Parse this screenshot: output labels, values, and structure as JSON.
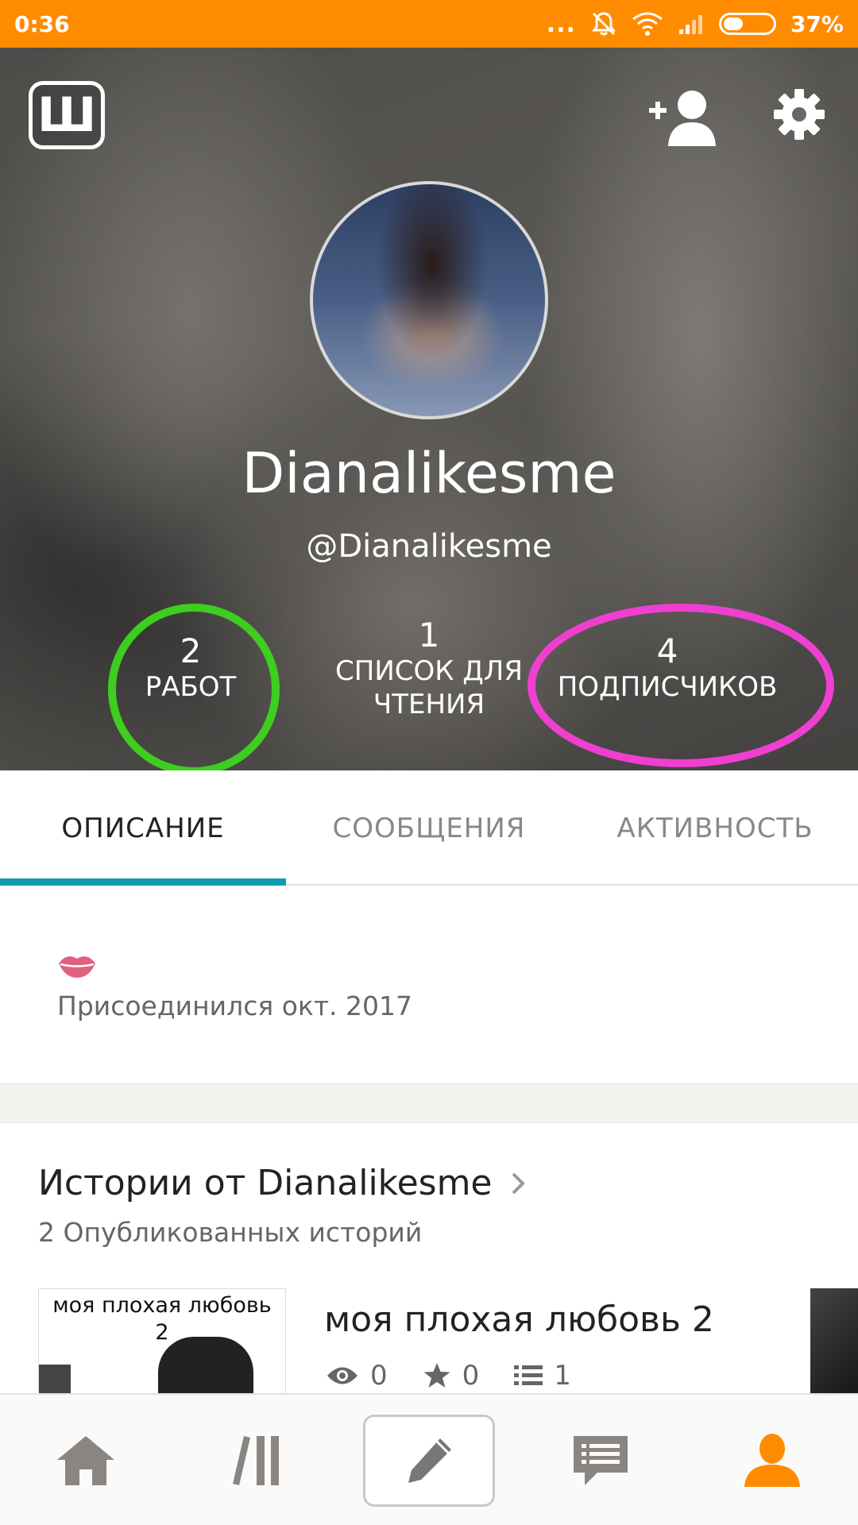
{
  "status_bar": {
    "time": "0:36",
    "dots": "...",
    "battery_percent": "37%",
    "battery_level": 0.37,
    "icons": [
      "mute-icon",
      "wifi-icon",
      "signal-icon",
      "battery-icon"
    ]
  },
  "header": {
    "logo_letter": "Ш",
    "display_name": "Dianalikesme",
    "handle": "@Dianalikesme",
    "stats": {
      "works": {
        "value": "2",
        "label": "РАБОТ"
      },
      "reading_list": {
        "value": "1",
        "label_line1": "СПИСОК ДЛЯ",
        "label_line2": "ЧТЕНИЯ"
      },
      "followers": {
        "value": "4",
        "label": "ПОДПИСЧИКОВ"
      }
    },
    "annotation_colors": {
      "green": "#3dce1f",
      "pink": "#ef3fcf"
    }
  },
  "tabs": [
    {
      "label": "ОПИСАНИЕ",
      "active": true
    },
    {
      "label": "СООБЩЕНИЯ",
      "active": false
    },
    {
      "label": "АКТИВНОСТЬ",
      "active": false
    }
  ],
  "about": {
    "joined": "Присоединился окт. 2017"
  },
  "stories": {
    "title": "Истории от Dianalikesme",
    "count_text": "2 Опубликованных историй",
    "items": [
      {
        "cover_text_line1": "моя плохая любовь",
        "cover_text_line2": "2",
        "title": "моя плохая любовь 2",
        "views": "0",
        "votes": "0",
        "parts": "1"
      }
    ]
  },
  "bottom_nav": {
    "items": [
      "home-icon",
      "library-icon",
      "write-icon",
      "messages-icon",
      "profile-icon"
    ],
    "active_color": "#ff8c00",
    "inactive_color": "#8a8580"
  },
  "colors": {
    "accent": "#ff8c00",
    "tab_indicator": "#0e9bb0"
  }
}
